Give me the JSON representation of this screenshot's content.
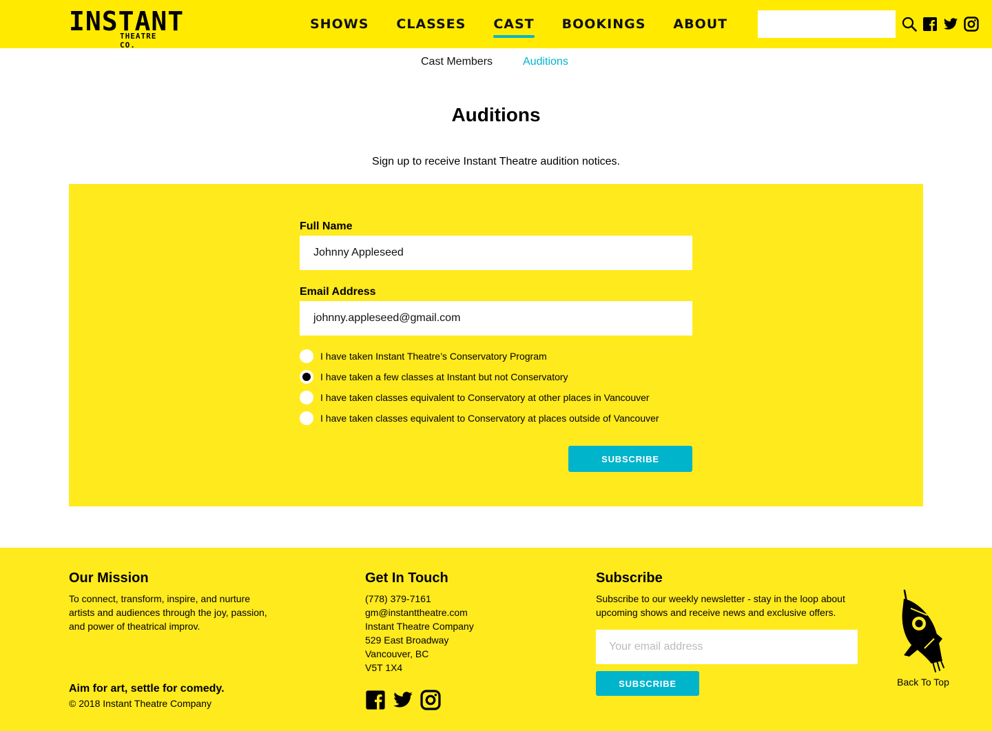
{
  "header": {
    "logo": {
      "main": "INSTANT",
      "sub": "THEATRE CO."
    },
    "nav": [
      {
        "label": "SHOWS",
        "active": false
      },
      {
        "label": "CLASSES",
        "active": false
      },
      {
        "label": "CAST",
        "active": true
      },
      {
        "label": "BOOKINGS",
        "active": false
      },
      {
        "label": "ABOUT",
        "active": false
      }
    ],
    "search": {
      "value": "",
      "placeholder": ""
    },
    "icons": [
      "search-icon",
      "facebook-icon",
      "twitter-icon",
      "instagram-icon"
    ]
  },
  "subnav": {
    "items": [
      {
        "label": "Cast Members",
        "active": false
      },
      {
        "label": "Auditions",
        "active": true
      }
    ]
  },
  "page": {
    "title": "Auditions",
    "intro": "Sign up to receive Instant Theatre audition notices."
  },
  "form": {
    "full_name": {
      "label": "Full Name",
      "value": "Johnny Appleseed"
    },
    "email": {
      "label": "Email Address",
      "value": "johnny.appleseed@gmail.com"
    },
    "options": [
      {
        "label": "I have taken Instant Theatre’s Conservatory Program",
        "checked": false
      },
      {
        "label": "I have taken a few classes at Instant but not Conservatory",
        "checked": true
      },
      {
        "label": "I have taken classes equivalent to Conservatory at other places in Vancouver",
        "checked": false
      },
      {
        "label": "I have taken classes equivalent to Conservatory at places outside of Vancouver",
        "checked": false
      }
    ],
    "submit_label": "SUBSCRIBE"
  },
  "footer": {
    "mission": {
      "heading": "Our Mission",
      "lines": [
        "To connect, transform, inspire, and nurture",
        "artists and audiences through the joy, passion,",
        "and power of theatrical improv."
      ],
      "tagline": "Aim for art, settle for comedy.",
      "copyright": "© 2018 Instant Theatre Company"
    },
    "contact": {
      "heading": "Get In Touch",
      "lines": [
        "(778) 379-7161",
        "gm@instanttheatre.com",
        "Instant Theatre Company",
        "529 East Broadway",
        "Vancouver, BC",
        "V5T 1X4"
      ],
      "social": [
        "facebook-icon",
        "twitter-icon",
        "instagram-icon"
      ]
    },
    "subscribe": {
      "heading": "Subscribe",
      "lines": [
        "Subscribe to our weekly newsletter - stay in the loop about",
        "upcoming shows and receive news and exclusive offers."
      ],
      "email_placeholder": "Your email address",
      "button_label": "SUBSCRIBE"
    },
    "back_to_top": "Back To Top"
  },
  "colors": {
    "brand_yellow": "#FFEA00",
    "panel_yellow": "#FFEA1E",
    "accent_cyan": "#00B4CC",
    "text": "#000000"
  }
}
